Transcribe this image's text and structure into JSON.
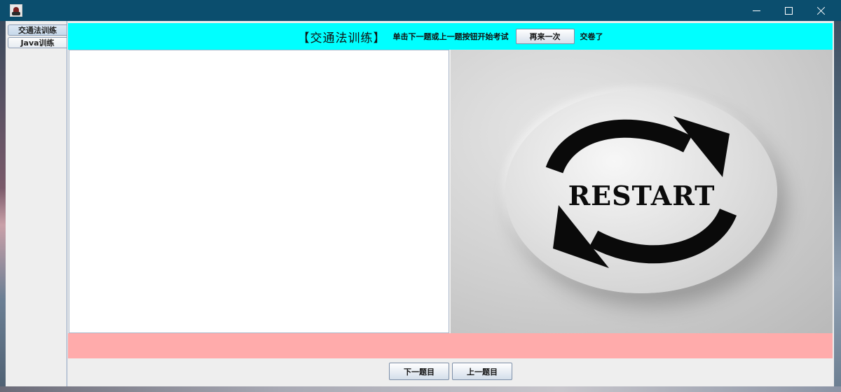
{
  "window": {
    "controls": {
      "minimize_icon": "minimize-icon",
      "maximize_icon": "maximize-icon",
      "close_icon": "close-icon"
    }
  },
  "tabs": [
    {
      "label": "交通法训练",
      "selected": true
    },
    {
      "label": "Java训练",
      "selected": false
    }
  ],
  "header": {
    "title": "【交通法训练】",
    "instruction": "单击下一题或上一题按钮开始考试",
    "restart_button": "再来一次",
    "submit_link": "交卷了",
    "background": "#00ffff"
  },
  "image": {
    "caption": "RESTART",
    "icon": "restart-arrows-icon"
  },
  "status_bar": {
    "background": "#ffabab"
  },
  "nav": {
    "next_button": "下一题目",
    "prev_button": "上一题目"
  }
}
